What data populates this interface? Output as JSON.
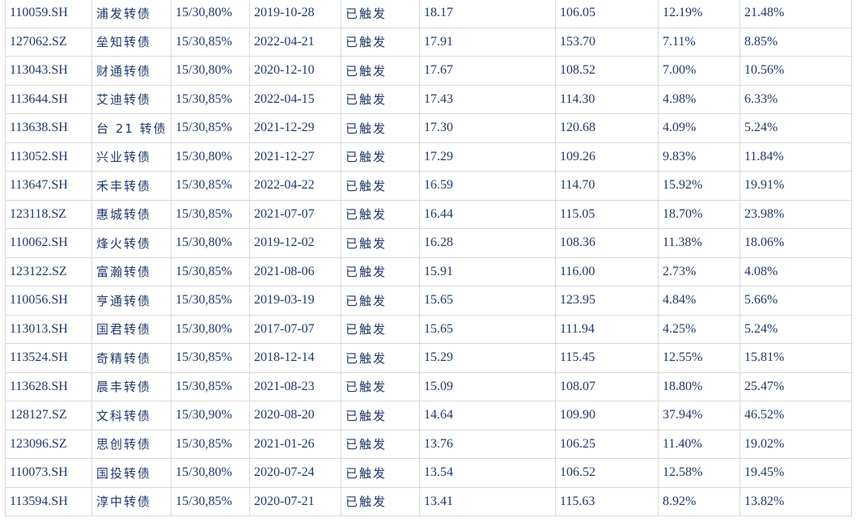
{
  "table": {
    "rows": [
      [
        "110059.SH",
        "浦发转债",
        "15/30,80%",
        "2019-10-28",
        "已触发",
        "18.17",
        "106.05",
        "12.19%",
        "21.48%"
      ],
      [
        "127062.SZ",
        "垒知转债",
        "15/30,85%",
        "2022-04-21",
        "已触发",
        "17.91",
        "153.70",
        "7.11%",
        "8.85%"
      ],
      [
        "113043.SH",
        "财通转债",
        "15/30,80%",
        "2020-12-10",
        "已触发",
        "17.67",
        "108.52",
        "7.00%",
        "10.56%"
      ],
      [
        "113644.SH",
        "艾迪转债",
        "15/30,85%",
        "2022-04-15",
        "已触发",
        "17.43",
        "114.30",
        "4.98%",
        "6.33%"
      ],
      [
        "113638.SH",
        "台 21 转债",
        "15/30,85%",
        "2021-12-29",
        "已触发",
        "17.30",
        "120.68",
        "4.09%",
        "5.24%"
      ],
      [
        "113052.SH",
        "兴业转债",
        "15/30,80%",
        "2021-12-27",
        "已触发",
        "17.29",
        "109.26",
        "9.83%",
        "11.84%"
      ],
      [
        "113647.SH",
        "禾丰转债",
        "15/30,85%",
        "2022-04-22",
        "已触发",
        "16.59",
        "114.70",
        "15.92%",
        "19.91%"
      ],
      [
        "123118.SZ",
        "惠城转债",
        "15/30,85%",
        "2021-07-07",
        "已触发",
        "16.44",
        "115.05",
        "18.70%",
        "23.98%"
      ],
      [
        "110062.SH",
        "烽火转债",
        "15/30,80%",
        "2019-12-02",
        "已触发",
        "16.28",
        "108.36",
        "11.38%",
        "18.06%"
      ],
      [
        "123122.SZ",
        "富瀚转债",
        "15/30,85%",
        "2021-08-06",
        "已触发",
        "15.91",
        "116.00",
        "2.73%",
        "4.08%"
      ],
      [
        "110056.SH",
        "亨通转债",
        "15/30,85%",
        "2019-03-19",
        "已触发",
        "15.65",
        "123.95",
        "4.84%",
        "5.66%"
      ],
      [
        "113013.SH",
        "国君转债",
        "15/30,80%",
        "2017-07-07",
        "已触发",
        "15.65",
        "111.94",
        "4.25%",
        "5.24%"
      ],
      [
        "113524.SH",
        "奇精转债",
        "15/30,85%",
        "2018-12-14",
        "已触发",
        "15.29",
        "115.45",
        "12.55%",
        "15.81%"
      ],
      [
        "113628.SH",
        "晨丰转债",
        "15/30,85%",
        "2021-08-23",
        "已触发",
        "15.09",
        "108.07",
        "18.80%",
        "25.47%"
      ],
      [
        "128127.SZ",
        "文科转债",
        "15/30,90%",
        "2020-08-20",
        "已触发",
        "14.64",
        "109.90",
        "37.94%",
        "46.52%"
      ],
      [
        "123096.SZ",
        "思创转债",
        "15/30,85%",
        "2021-01-26",
        "已触发",
        "13.76",
        "106.25",
        "11.40%",
        "19.02%"
      ],
      [
        "110073.SH",
        "国投转债",
        "15/30,80%",
        "2020-07-24",
        "已触发",
        "13.54",
        "106.52",
        "12.58%",
        "19.45%"
      ],
      [
        "113594.SH",
        "淳中转债",
        "15/30,85%",
        "2020-07-21",
        "已触发",
        "13.41",
        "115.63",
        "8.92%",
        "13.82%"
      ]
    ]
  }
}
